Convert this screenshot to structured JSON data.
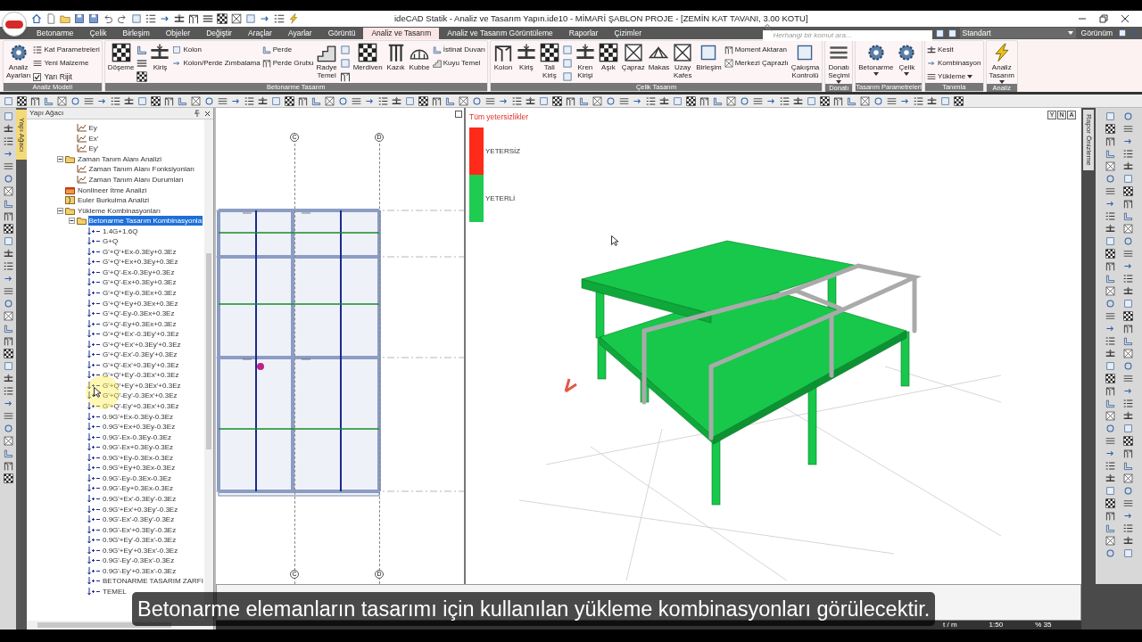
{
  "window": {
    "title": "ideCAD Statik - Analiz ve Tasarım Yapın.ide10 - MİMARİ ŞABLON PROJE - [ZEMİN KAT TAVANI,  3.00 KOTU]"
  },
  "menu_tabs": [
    {
      "label": "Betonarme",
      "selected": false
    },
    {
      "label": "Çelik",
      "selected": false
    },
    {
      "label": "Birleşim",
      "selected": false
    },
    {
      "label": "Objeler",
      "selected": false
    },
    {
      "label": "Değiştir",
      "selected": false
    },
    {
      "label": "Araçlar",
      "selected": false
    },
    {
      "label": "Ayarlar",
      "selected": false
    },
    {
      "label": "Görüntü",
      "selected": false
    },
    {
      "label": "Analiz ve Tasarım",
      "selected": true
    },
    {
      "label": "Analiz ve Tasarım Görüntüleme",
      "selected": false
    },
    {
      "label": "Raporlar",
      "selected": false
    },
    {
      "label": "Çizimler",
      "selected": false
    }
  ],
  "search": {
    "placeholder": "Herhangi bir komut ara..."
  },
  "workspace": {
    "value": "Standart"
  },
  "view_menu": {
    "label": "Görünüm"
  },
  "ribbon": [
    {
      "title": "Analiz Modeli",
      "columns": [
        [
          {
            "kind": "large",
            "label": "Analiz Ayarları",
            "dropdown": false
          }
        ],
        [
          {
            "kind": "small",
            "label": "Kat Parametreleri",
            "dropdown": false
          },
          {
            "kind": "small",
            "label": "Yeni Malzeme",
            "dropdown": false
          },
          {
            "kind": "check",
            "label": "Yarı Rijit",
            "checked": true
          }
        ]
      ]
    },
    {
      "title": "Betonarme Tasarım",
      "columns": [
        [
          {
            "kind": "large",
            "label": "Döşeme",
            "dropdown": false
          }
        ],
        [
          {
            "kind": "icon"
          },
          {
            "kind": "icon"
          },
          {
            "kind": "icon"
          }
        ],
        [
          {
            "kind": "large",
            "label": "Kiriş",
            "dropdown": false
          }
        ],
        [
          {
            "kind": "small",
            "label": "Kolon",
            "dropdown": false
          },
          {
            "kind": "small",
            "label": "Kolon/Perde Zımbalama",
            "dropdown": false
          }
        ],
        [
          {
            "kind": "small",
            "label": "Perde",
            "dropdown": false
          },
          {
            "kind": "small",
            "label": "Perde Grubu",
            "dropdown": false
          }
        ],
        [
          {
            "kind": "large",
            "label": "Radye Temel",
            "dropdown": false
          }
        ],
        [
          {
            "kind": "icon"
          },
          {
            "kind": "icon"
          },
          {
            "kind": "icon"
          }
        ],
        [
          {
            "kind": "large",
            "label": "Merdiven",
            "dropdown": false
          }
        ],
        [
          {
            "kind": "large",
            "label": "Kazık",
            "dropdown": false
          }
        ],
        [
          {
            "kind": "large",
            "label": "Kubbe",
            "dropdown": false
          }
        ],
        [
          {
            "kind": "small",
            "label": "İstinat Duvarı",
            "dropdown": false
          },
          {
            "kind": "small",
            "label": "Kuyu Temel",
            "dropdown": false
          }
        ]
      ]
    },
    {
      "title": "Çelik Tasarım",
      "columns": [
        [
          {
            "kind": "large",
            "label": "Kolon",
            "dropdown": false
          }
        ],
        [
          {
            "kind": "large",
            "label": "Kiriş",
            "dropdown": false
          }
        ],
        [
          {
            "kind": "large",
            "label": "Tali Kiriş",
            "dropdown": false
          }
        ],
        [
          {
            "kind": "icon"
          },
          {
            "kind": "icon"
          },
          {
            "kind": "icon"
          }
        ],
        [
          {
            "kind": "large",
            "label": "Kren Kirişi",
            "dropdown": false
          }
        ],
        [
          {
            "kind": "large",
            "label": "Aşık",
            "dropdown": false
          }
        ],
        [
          {
            "kind": "large",
            "label": "Çapraz",
            "dropdown": false
          }
        ],
        [
          {
            "kind": "large",
            "label": "Makas",
            "dropdown": false
          }
        ],
        [
          {
            "kind": "large",
            "label": "Uzay Kafes",
            "dropdown": false
          }
        ],
        [
          {
            "kind": "large",
            "label": "Birleşim",
            "dropdown": false
          }
        ],
        [
          {
            "kind": "small",
            "label": "Moment Aktaran",
            "dropdown": false
          },
          {
            "kind": "small",
            "label": "Merkezi Çaprazlı",
            "dropdown": false
          }
        ],
        [
          {
            "kind": "large",
            "label": "Çakışma Kontrolü",
            "dropdown": false
          }
        ]
      ]
    },
    {
      "title": "Donatı",
      "columns": [
        [
          {
            "kind": "large",
            "label": "Donatı Seçimi",
            "dropdown": true
          }
        ]
      ]
    },
    {
      "title": "Tasarım Parametreleri",
      "columns": [
        [
          {
            "kind": "large",
            "label": "Betonarme",
            "dropdown": true
          }
        ],
        [
          {
            "kind": "large",
            "label": "Çelik",
            "dropdown": true
          }
        ]
      ]
    },
    {
      "title": "Tanımla",
      "columns": [
        [
          {
            "kind": "small",
            "label": "Kesit",
            "dropdown": false
          },
          {
            "kind": "small",
            "label": "Kombinasyon",
            "dropdown": false
          },
          {
            "kind": "small",
            "label": "Yükleme",
            "dropdown": true
          }
        ]
      ]
    },
    {
      "title": "Analiz",
      "columns": [
        [
          {
            "kind": "large",
            "label": "Analiz Tasarım",
            "dropdown": true
          }
        ]
      ]
    }
  ],
  "side_tabs": {
    "left": "Yapı Ağacı",
    "right": "Rapor Önizleme"
  },
  "tree": {
    "title": "Yapı Ağacı",
    "items": [
      {
        "children": [
          {
            "label": "Ey",
            "kind": "chart",
            "selected": false
          },
          {
            "label": "Ex'",
            "kind": "chart",
            "selected": false
          },
          {
            "label": "Ey'",
            "kind": "chart",
            "selected": false
          }
        ]
      },
      {
        "label": "Zaman Tanım Alanı Analizi",
        "kind": "folder",
        "selected": false,
        "expanded": true,
        "children": [
          {
            "label": "Zaman Tanım Alanı Fonksiyonları",
            "kind": "chart",
            "selected": false
          },
          {
            "label": "Zaman Tanım Alanı Durumları",
            "kind": "chart",
            "selected": false
          }
        ]
      },
      {
        "label": "Nonlineer İtme Analizi",
        "kind": "pushover",
        "selected": false
      },
      {
        "label": "Euler Burkulma Analizi",
        "kind": "buckling",
        "selected": false
      },
      {
        "label": "Yükleme Kombinasyonları",
        "kind": "folder",
        "selected": false,
        "expanded": true,
        "children": [
          {
            "label": "Betonarme Tasarım Kombinasyonla",
            "kind": "folder",
            "selected": true,
            "expanded": true,
            "children": [
              {
                "label": "1.4G+1.6Q",
                "kind": "combination",
                "selected": false
              },
              {
                "label": "G+Q",
                "kind": "combination",
                "selected": false
              },
              {
                "label": "G'+Q'+Ex-0.3Ey+0.3Ez",
                "kind": "combination",
                "selected": false
              },
              {
                "label": "G'+Q'+Ex+0.3Ey+0.3Ez",
                "kind": "combination",
                "selected": false
              },
              {
                "label": "G'+Q'-Ex-0.3Ey+0.3Ez",
                "kind": "combination",
                "selected": false
              },
              {
                "label": "G'+Q'-Ex+0.3Ey+0.3Ez",
                "kind": "combination",
                "selected": false
              },
              {
                "label": "G'+Q'+Ey-0.3Ex+0.3Ez",
                "kind": "combination",
                "selected": false
              },
              {
                "label": "G'+Q'+Ey+0.3Ex+0.3Ez",
                "kind": "combination",
                "selected": false
              },
              {
                "label": "G'+Q'-Ey-0.3Ex+0.3Ez",
                "kind": "combination",
                "selected": false
              },
              {
                "label": "G'+Q'-Ey+0.3Ex+0.3Ez",
                "kind": "combination",
                "selected": false
              },
              {
                "label": "G'+Q'+Ex'-0.3Ey'+0.3Ez",
                "kind": "combination",
                "selected": false
              },
              {
                "label": "G'+Q'+Ex'+0.3Ey'+0.3Ez",
                "kind": "combination",
                "selected": false
              },
              {
                "label": "G'+Q'-Ex'-0.3Ey'+0.3Ez",
                "kind": "combination",
                "selected": false
              },
              {
                "label": "G'+Q'-Ex'+0.3Ey'+0.3Ez",
                "kind": "combination",
                "selected": false
              },
              {
                "label": "G'+Q'+Ey'-0.3Ex'+0.3Ez",
                "kind": "combination",
                "selected": false
              },
              {
                "label": "G'+Q'+Ey'+0.3Ex'+0.3Ez",
                "kind": "combination",
                "selected": false
              },
              {
                "label": "G'+Q'-Ey'-0.3Ex'+0.3Ez",
                "kind": "combination",
                "selected": false
              },
              {
                "label": "G'+Q'-Ey'+0.3Ex'+0.3Ez",
                "kind": "combination",
                "selected": false
              },
              {
                "label": "0.9G'+Ex-0.3Ey-0.3Ez",
                "kind": "combination",
                "selected": false
              },
              {
                "label": "0.9G'+Ex+0.3Ey-0.3Ez",
                "kind": "combination",
                "selected": false
              },
              {
                "label": "0.9G'-Ex-0.3Ey-0.3Ez",
                "kind": "combination",
                "selected": false
              },
              {
                "label": "0.9G'-Ex+0.3Ey-0.3Ez",
                "kind": "combination",
                "selected": false
              },
              {
                "label": "0.9G'+Ey-0.3Ex-0.3Ez",
                "kind": "combination",
                "selected": false
              },
              {
                "label": "0.9G'+Ey+0.3Ex-0.3Ez",
                "kind": "combination",
                "selected": false
              },
              {
                "label": "0.9G'-Ey-0.3Ex-0.3Ez",
                "kind": "combination",
                "selected": false
              },
              {
                "label": "0.9G'-Ey+0.3Ex-0.3Ez",
                "kind": "combination",
                "selected": false
              },
              {
                "label": "0.9G'+Ex'-0.3Ey'-0.3Ez",
                "kind": "combination",
                "selected": false
              },
              {
                "label": "0.9G'+Ex'+0.3Ey'-0.3Ez",
                "kind": "combination",
                "selected": false
              },
              {
                "label": "0.9G'-Ex'-0.3Ey'-0.3Ez",
                "kind": "combination",
                "selected": false
              },
              {
                "label": "0.9G'-Ex'+0.3Ey'-0.3Ez",
                "kind": "combination",
                "selected": false
              },
              {
                "label": "0.9G'+Ey'-0.3Ex'-0.3Ez",
                "kind": "combination",
                "selected": false
              },
              {
                "label": "0.9G'+Ey'+0.3Ex'-0.3Ez",
                "kind": "combination",
                "selected": false
              },
              {
                "label": "0.9G'-Ey'-0.3Ex'-0.3Ez",
                "kind": "combination",
                "selected": false
              },
              {
                "label": "0.9G'-Ey'+0.3Ex'-0.3Ez",
                "kind": "combination",
                "selected": false
              },
              {
                "label": "BETONARME TASARIM ZARFI",
                "kind": "combination",
                "selected": false
              },
              {
                "label": "TEMEL",
                "kind": "combination",
                "selected": false
              }
            ]
          }
        ]
      }
    ]
  },
  "plan": {
    "axes_top": [
      "C",
      "D"
    ],
    "axes_bottom": [
      "C",
      "D"
    ]
  },
  "view3d": {
    "legend_title": "Tüm yetersizlikler",
    "legend": [
      {
        "label": "YETERSİZ",
        "color": "#ff2a1a"
      },
      {
        "label": "YETERLİ",
        "color": "#1fcc52"
      }
    ],
    "view_buttons": [
      "Y",
      "N",
      "A"
    ]
  },
  "status_bar": [
    "t / m",
    "1:50",
    "% 35"
  ],
  "subtitle": "Betonarme elemanların tasarımı için kullanılan yükleme kombinasyonları görülecektir."
}
